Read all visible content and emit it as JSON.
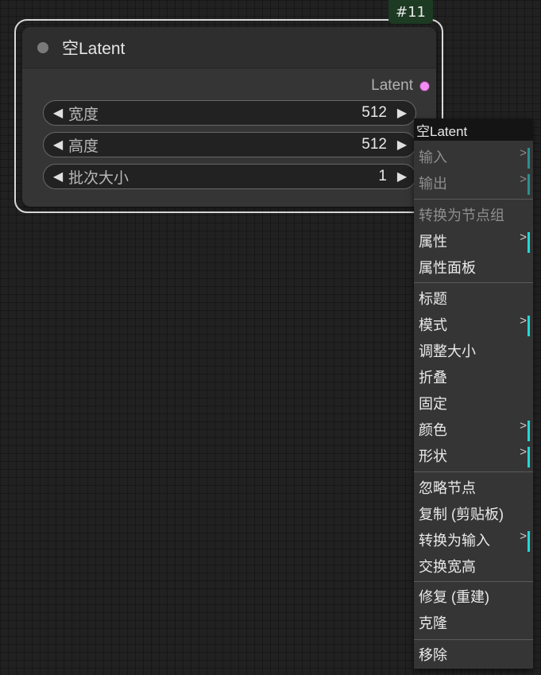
{
  "node": {
    "badge": "#11",
    "title": "空Latent",
    "output_label": "Latent",
    "output_color": "#f28cf2",
    "widgets": [
      {
        "label": "宽度",
        "value": "512"
      },
      {
        "label": "高度",
        "value": "512"
      },
      {
        "label": "批次大小",
        "value": "1"
      }
    ],
    "arrow_left": "◀",
    "arrow_right": "▶"
  },
  "context_menu": {
    "title": "空Latent",
    "submenu_glyph": ">",
    "accent_color": "#22d8d8",
    "items": [
      {
        "label": "输入",
        "disabled": true,
        "submenu": true
      },
      {
        "label": "输出",
        "disabled": true,
        "submenu": true
      },
      {
        "label": "转换为节点组",
        "disabled": true,
        "submenu": false
      },
      {
        "label": "属性",
        "disabled": false,
        "submenu": true
      },
      {
        "label": "属性面板",
        "disabled": false,
        "submenu": false
      },
      {
        "label": "标题",
        "disabled": false,
        "submenu": false
      },
      {
        "label": "模式",
        "disabled": false,
        "submenu": true
      },
      {
        "label": "调整大小",
        "disabled": false,
        "submenu": false
      },
      {
        "label": "折叠",
        "disabled": false,
        "submenu": false
      },
      {
        "label": "固定",
        "disabled": false,
        "submenu": false
      },
      {
        "label": "颜色",
        "disabled": false,
        "submenu": true
      },
      {
        "label": "形状",
        "disabled": false,
        "submenu": true
      },
      {
        "label": "忽略节点",
        "disabled": false,
        "submenu": false
      },
      {
        "label": "复制 (剪贴板)",
        "disabled": false,
        "submenu": false
      },
      {
        "label": "转换为输入",
        "disabled": false,
        "submenu": true
      },
      {
        "label": "交换宽高",
        "disabled": false,
        "submenu": false
      },
      {
        "label": "修复 (重建)",
        "disabled": false,
        "submenu": false
      },
      {
        "label": "克隆",
        "disabled": false,
        "submenu": false
      },
      {
        "label": "移除",
        "disabled": false,
        "submenu": false
      }
    ]
  }
}
